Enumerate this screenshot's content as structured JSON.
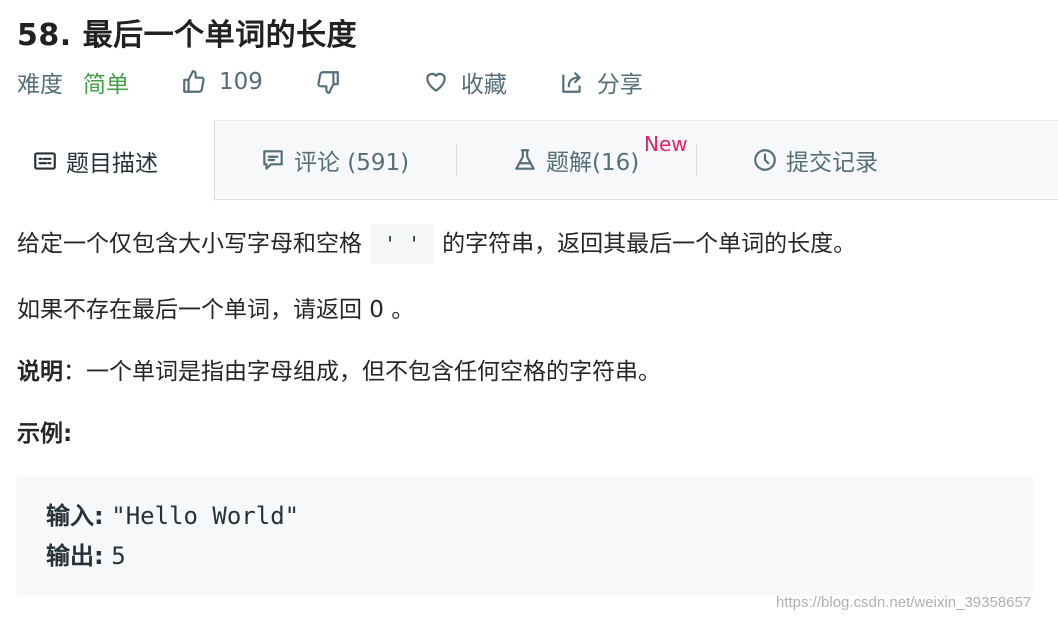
{
  "problem": {
    "title": "58. 最后一个单词的长度"
  },
  "meta": {
    "difficulty_label": "难度",
    "difficulty_value": "简单",
    "likes": "109",
    "favorite_label": "收藏",
    "share_label": "分享",
    "difficulty_color": "#43a047"
  },
  "tabs": [
    {
      "label": "题目描述",
      "icon": "description-icon"
    },
    {
      "label": "评论 (591)",
      "icon": "comment-icon"
    },
    {
      "label": "题解(16)",
      "icon": "flask-icon",
      "badge": "New"
    },
    {
      "label": "提交记录",
      "icon": "clock-icon"
    }
  ],
  "content": {
    "p1_before": "给定一个仅包含大小写字母和空格",
    "p1_code": "' '",
    "p1_after": "的字符串，返回其最后一个单词的长度。",
    "p2": "如果不存在最后一个单词，请返回 0 。",
    "p3_label": "说明",
    "p3_text": "：一个单词是指由字母组成，但不包含任何空格的字符串。",
    "p4": "示例:"
  },
  "example": {
    "input_label": "输入:",
    "input_value": "\"Hello World\"",
    "output_label": "输出:",
    "output_value": "5"
  },
  "watermark": "https://blog.csdn.net/weixin_39358657",
  "colors": {
    "accent_new": "#e91e63",
    "text_secondary": "#546e7a"
  }
}
